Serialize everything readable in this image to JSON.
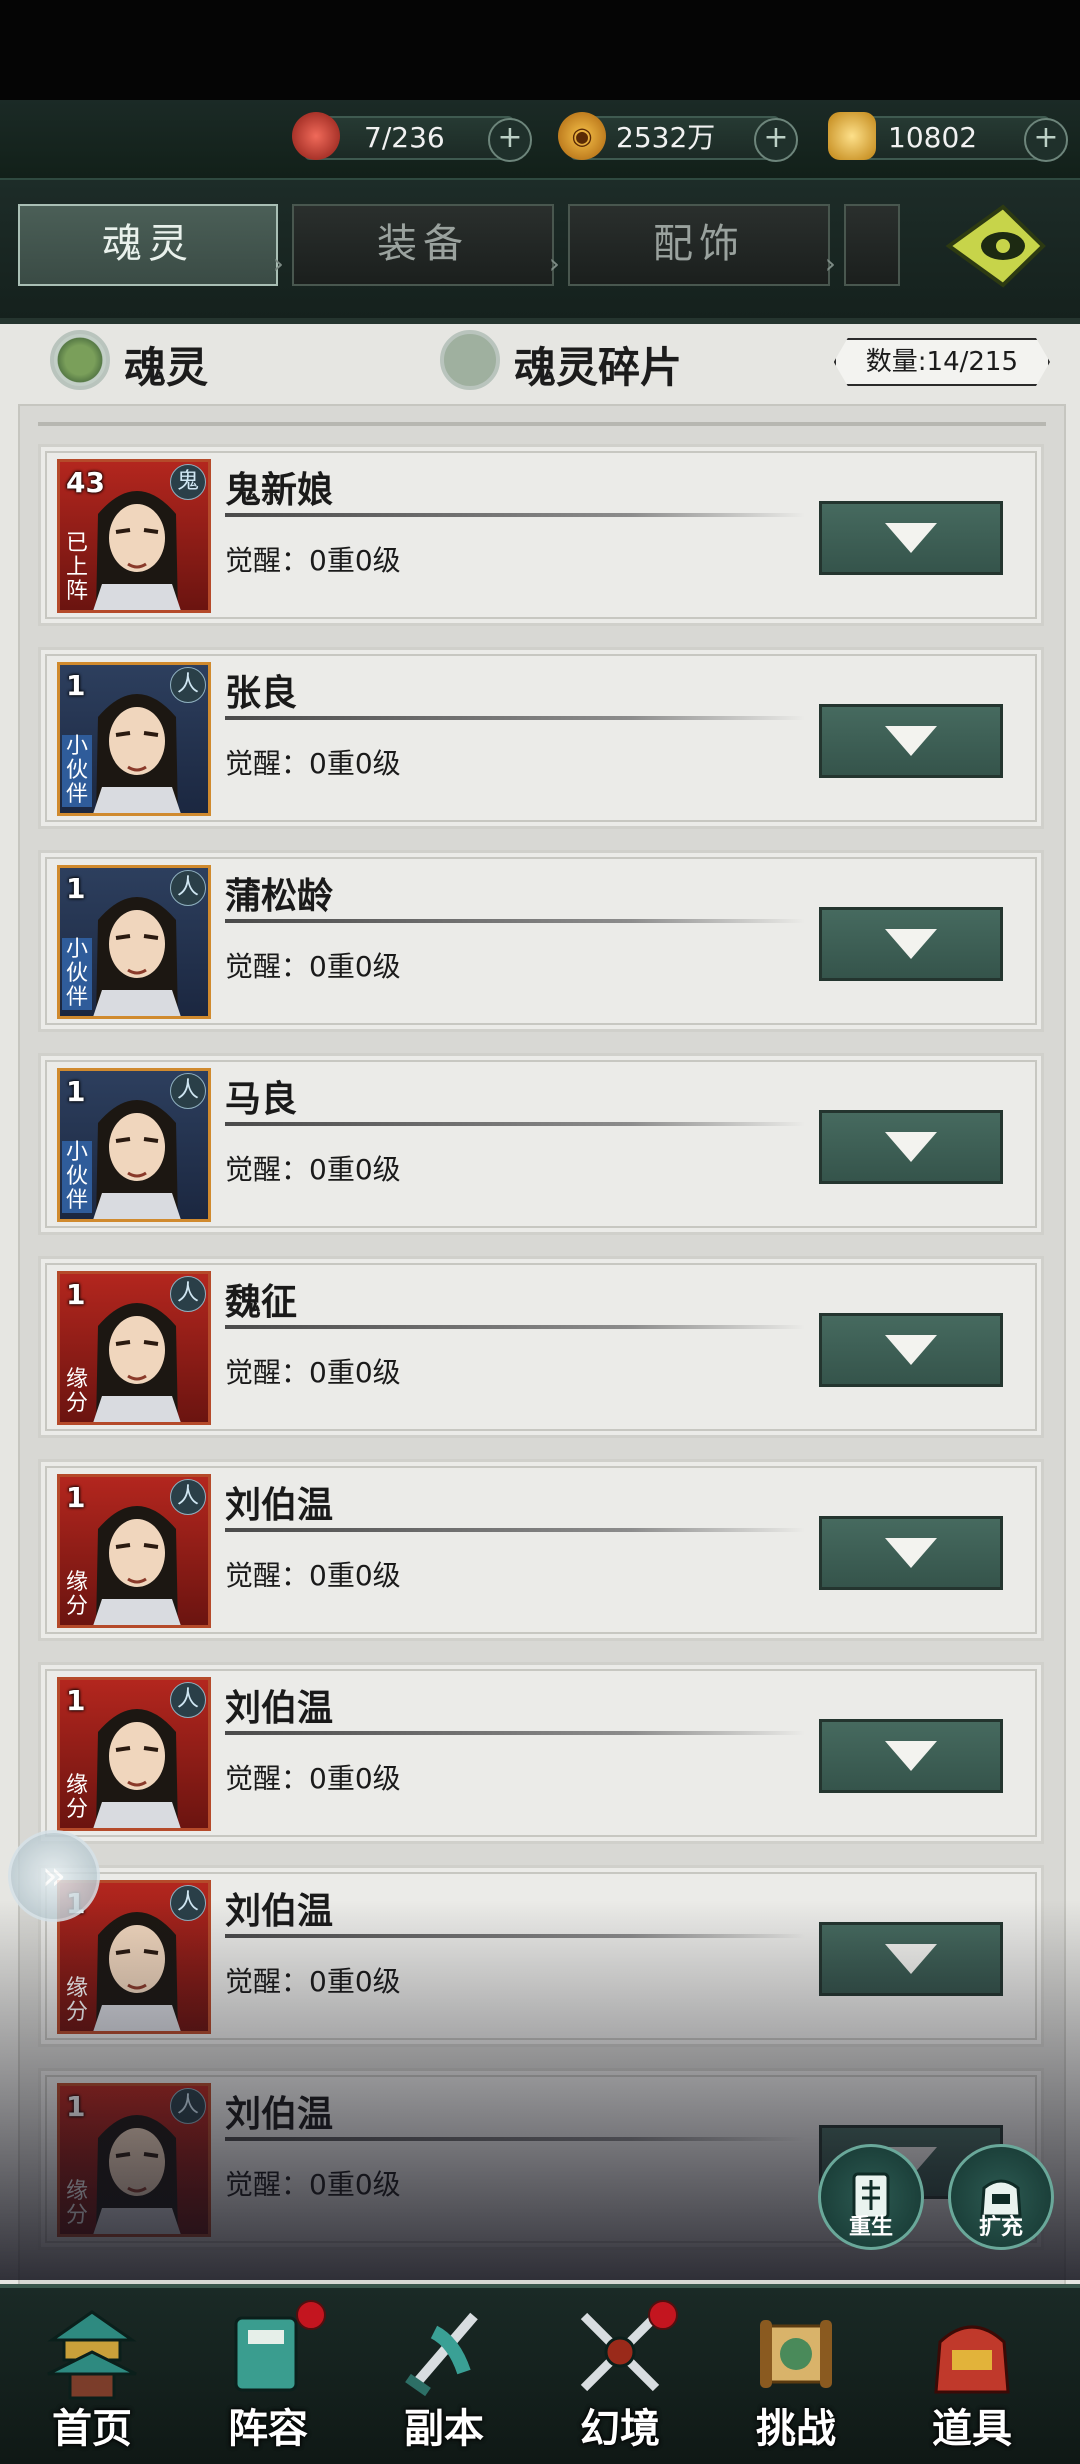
{
  "resources": [
    {
      "icon": "orb-icon",
      "value": "7/236",
      "color": "#c0392b"
    },
    {
      "icon": "coin-icon",
      "value": "2532万",
      "color": "#d59b1d"
    },
    {
      "icon": "ingot-icon",
      "value": "10802",
      "color": "#e2b33a"
    }
  ],
  "tabs": [
    {
      "label": "魂灵",
      "active": true
    },
    {
      "label": "装备",
      "active": false
    },
    {
      "label": "配饰",
      "active": false
    },
    {
      "label": "",
      "active": false
    }
  ],
  "filter": {
    "option_soul": "魂灵",
    "option_fragment": "魂灵碎片",
    "count": "数量:14/215"
  },
  "items": [
    {
      "name": "鬼新娘",
      "awaken": "觉醒：0重0级",
      "level": "43",
      "type_glyph": "鬼",
      "tag": "已上阵",
      "frame": "red"
    },
    {
      "name": "张良",
      "awaken": "觉醒：0重0级",
      "level": "1",
      "type_glyph": "人",
      "tag": "小伙伴",
      "frame": "blue"
    },
    {
      "name": "蒲松龄",
      "awaken": "觉醒：0重0级",
      "level": "1",
      "type_glyph": "人",
      "tag": "小伙伴",
      "frame": "blue"
    },
    {
      "name": "马良",
      "awaken": "觉醒：0重0级",
      "level": "1",
      "type_glyph": "人",
      "tag": "小伙伴",
      "frame": "blue"
    },
    {
      "name": "魏征",
      "awaken": "觉醒：0重0级",
      "level": "1",
      "type_glyph": "人",
      "tag": "缘分",
      "frame": "red"
    },
    {
      "name": "刘伯温",
      "awaken": "觉醒：0重0级",
      "level": "1",
      "type_glyph": "人",
      "tag": "缘分",
      "frame": "red"
    },
    {
      "name": "刘伯温",
      "awaken": "觉醒：0重0级",
      "level": "1",
      "type_glyph": "人",
      "tag": "缘分",
      "frame": "red"
    },
    {
      "name": "刘伯温",
      "awaken": "觉醒：0重0级",
      "level": "1",
      "type_glyph": "人",
      "tag": "缘分",
      "frame": "red"
    },
    {
      "name": "刘伯温",
      "awaken": "觉醒：0重0级",
      "level": "1",
      "type_glyph": "人",
      "tag": "缘分",
      "frame": "red"
    }
  ],
  "floating": {
    "rebirth": "重生",
    "expand": "扩充"
  },
  "nav": [
    {
      "label": "首页",
      "icon": "pagoda-icon",
      "dot": false
    },
    {
      "label": "阵容",
      "icon": "book-icon",
      "dot": true
    },
    {
      "label": "副本",
      "icon": "sword-icon",
      "dot": false
    },
    {
      "label": "幻境",
      "icon": "crossed-swords-icon",
      "dot": true
    },
    {
      "label": "挑战",
      "icon": "scroll-icon",
      "dot": false
    },
    {
      "label": "道具",
      "icon": "bag-icon",
      "dot": false
    }
  ]
}
